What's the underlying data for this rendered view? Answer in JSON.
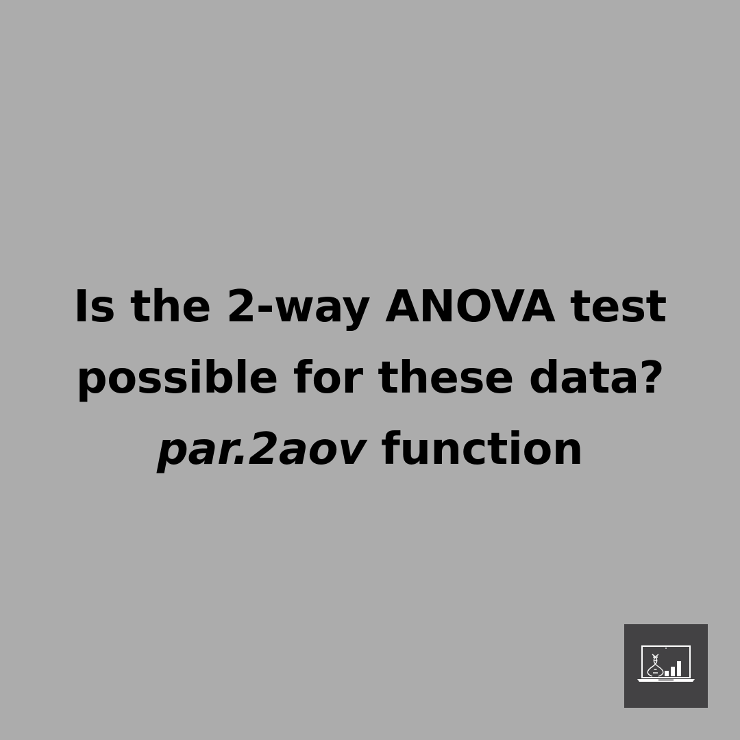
{
  "question": {
    "line1": "Is the 2-way ANOVA test",
    "line2": "possible for these data?",
    "function_name": "par.2aov",
    "function_suffix": " function"
  },
  "logo": {
    "icon": "laptop-dna-barchart-icon",
    "background_color": "#434244",
    "foreground_color": "#ffffff"
  },
  "colors": {
    "background": "#acacac",
    "text": "#000000"
  }
}
